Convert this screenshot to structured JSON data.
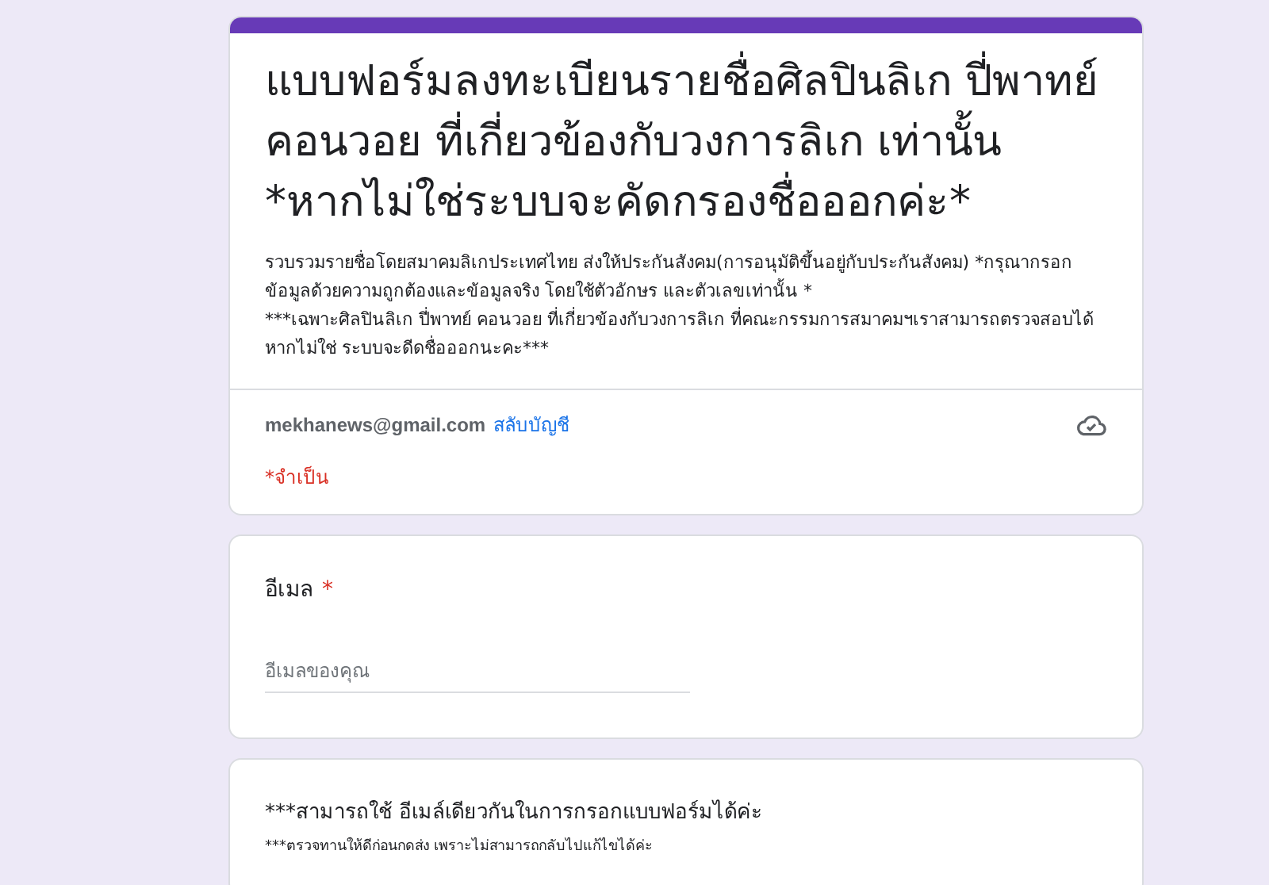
{
  "header": {
    "title": "แบบฟอร์มลงทะเบียนรายชื่อศิลปินลิเก ปี่พาทย์ คอนวอย ที่เกี่ยวข้องกับวงการลิเก เท่านั้น *หากไม่ใช่ระบบจะคัดกรองชื่อออกค่ะ*",
    "description": [
      "รวบรวมรายชื่อโดยสมาคมลิเกประเทศไทย ส่งให้ประกันสังคม(การอนุมัติขึ้นอยู่กับประกันสังคม) *กรุณากรอกข้อมูลด้วยความถูกต้องและข้อมูลจริง โดยใช้ตัวอักษร และตัวเลขเท่านั้น *",
      "***เฉพาะศิลปินลิเก ปี่พาทย์ คอนวอย ที่เกี่ยวข้องกับวงการลิเก ที่คณะกรรมการสมาคมฯเราสามารถตรวจสอบได้ หากไม่ใช่ ระบบจะดีดชื่อออกนะคะ***"
    ],
    "account": "mekhanews@gmail.com",
    "switch_account": "สลับบัญชี",
    "required_note": "*จำเป็น"
  },
  "email_question": {
    "label": "อีเมล",
    "required_mark": "*",
    "placeholder": "อีเมลของคุณ"
  },
  "notice": {
    "title": "***สามารถใช้ อีเมล์เดียวกันในการกรอกแบบฟอร์มได้ค่ะ",
    "text": "***ตรวจทานให้ดีก่อนกดส่ง เพราะไม่สามารถกลับไปแก้ไขได้ค่ะ"
  }
}
